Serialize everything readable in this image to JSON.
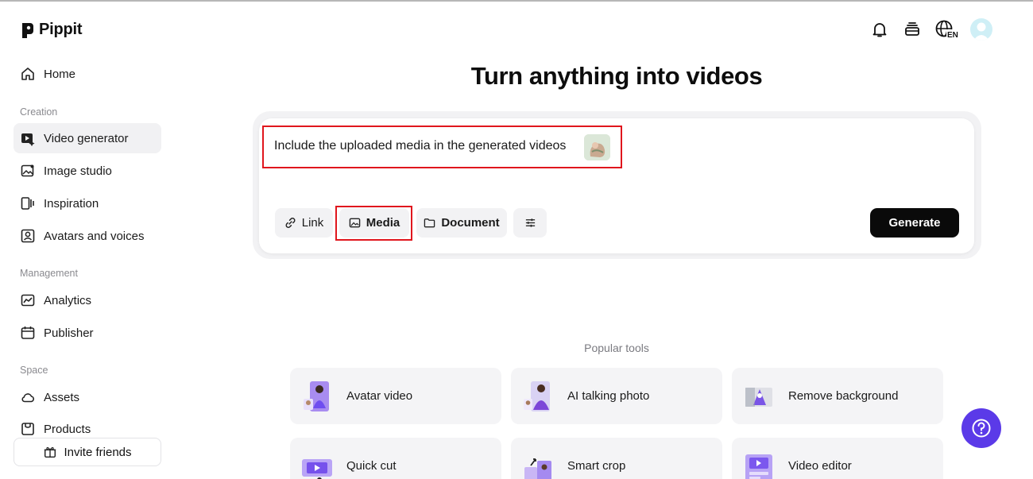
{
  "brand": {
    "name": "Pippit"
  },
  "header": {
    "icons": [
      "bell-icon",
      "stack-icon",
      "globe-icon",
      "avatar"
    ],
    "language": "EN"
  },
  "sidebar": {
    "home": "Home",
    "sections": {
      "creation": "Creation",
      "management": "Management",
      "space": "Space"
    },
    "items": {
      "video_generator": "Video generator",
      "image_studio": "Image studio",
      "inspiration": "Inspiration",
      "avatars_voices": "Avatars and voices",
      "analytics": "Analytics",
      "publisher": "Publisher",
      "assets": "Assets",
      "products": "Products"
    },
    "invite": "Invite friends"
  },
  "main": {
    "title": "Turn anything into videos",
    "prompt": {
      "text": "Include the uploaded media in the generated videos"
    },
    "chips": {
      "link": "Link",
      "media": "Media",
      "document": "Document"
    },
    "generate": "Generate",
    "popular_label": "Popular tools",
    "tools": {
      "avatar_video": "Avatar video",
      "ai_talking_photo": "AI talking photo",
      "remove_background": "Remove background",
      "quick_cut": "Quick cut",
      "smart_crop": "Smart crop",
      "video_editor": "Video editor"
    }
  },
  "colors": {
    "accent": "#5b3ae8",
    "highlight": "#e0161d",
    "primary_button": "#0a0a0a"
  }
}
